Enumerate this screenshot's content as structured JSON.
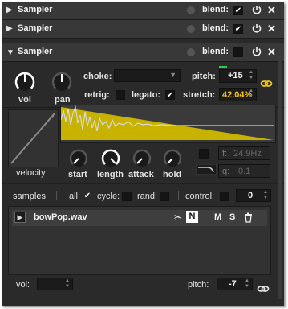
{
  "headers": [
    {
      "title": "Sampler",
      "blend_label": "blend:",
      "arrow": "▶"
    },
    {
      "title": "Sampler",
      "blend_label": "blend:",
      "arrow": "▶"
    },
    {
      "title": "Sampler",
      "blend_label": "blend:",
      "arrow": "▼"
    }
  ],
  "knobs": {
    "vol": "vol",
    "pan": "pan"
  },
  "controls": {
    "choke_label": "choke:",
    "choke_value": "",
    "retrig_label": "retrig:",
    "legato_label": "legato:",
    "pitch_label": "pitch:",
    "pitch_value": "+15",
    "stretch_label": "stretch:",
    "stretch_value": "42.04%"
  },
  "envelope": {
    "velocity_label": "velocity",
    "start_label": "start",
    "length_label": "length",
    "attack_label": "attack",
    "hold_label": "hold",
    "filter_f_label": "f:",
    "filter_f_value": "24.9Hz",
    "filter_q_label": "q:",
    "filter_q_value": "0.1"
  },
  "samples_bar": {
    "samples_label": "samples",
    "all_label": "all:",
    "cycle_label": "cycle:",
    "rand_label": "rand:",
    "control_label": "control:",
    "control_value": "0"
  },
  "sample": {
    "name": "bowPop.wav",
    "n_label": "N",
    "m_label": "M",
    "s_label": "S"
  },
  "bottom": {
    "vol_label": "vol:",
    "pitch_label": "pitch:",
    "pitch_value": "-7"
  },
  "colors": {
    "accent_yellow": "#f1c40f",
    "waveform": "#c7b200",
    "panel": "#2a2a2a",
    "header": "#383838"
  }
}
